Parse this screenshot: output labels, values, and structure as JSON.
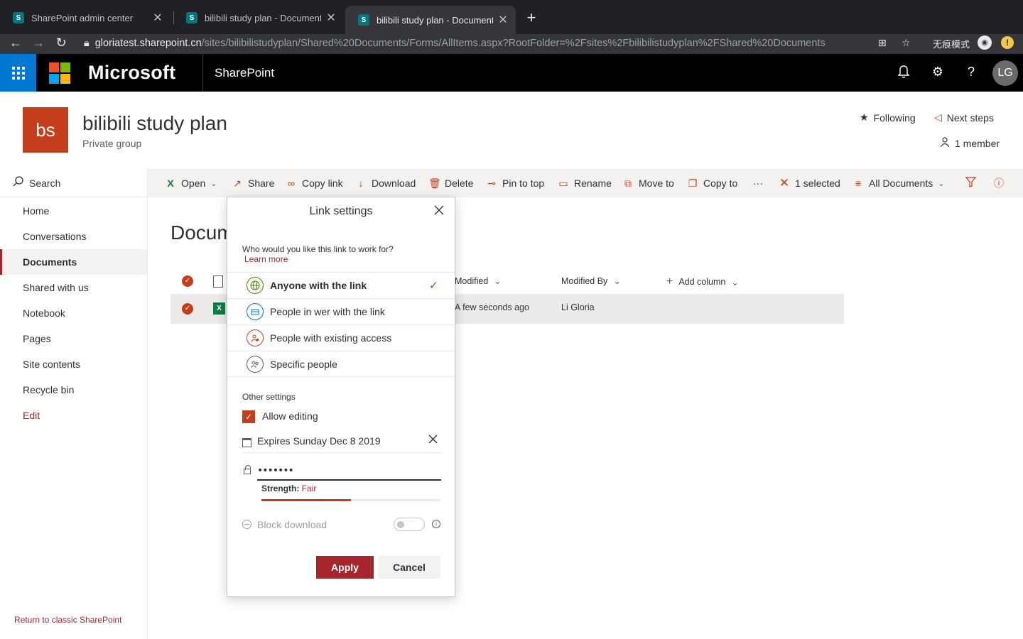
{
  "browser": {
    "tabs": [
      {
        "title": "SharePoint admin center",
        "favicon": "S"
      },
      {
        "title": "bilibili study plan - Documents",
        "favicon": "S"
      },
      {
        "title": "bilibili study plan - Documents",
        "favicon": "S"
      }
    ],
    "url_host": "gloriatest.sharepoint.cn",
    "url_path": "/sites/bilibilistudyplan/Shared%20Documents/Forms/AllItems.aspx?RootFolder=%2Fsites%2Fbilibilistudyplan%2FShared%20Documents",
    "incognito_label": "无痕模式"
  },
  "suitebar": {
    "brand": "Microsoft",
    "app": "SharePoint",
    "avatar_initials": "LG"
  },
  "site": {
    "logo_initials": "bs",
    "title": "bilibili study plan",
    "subtitle": "Private group",
    "following": "Following",
    "next_steps": "Next steps",
    "members": "1 member"
  },
  "leftnav": {
    "search": "Search",
    "items": [
      "Home",
      "Conversations",
      "Documents",
      "Shared with us",
      "Notebook",
      "Pages",
      "Site contents",
      "Recycle bin",
      "Edit"
    ],
    "classic": "Return to classic SharePoint"
  },
  "commands": {
    "open": "Open",
    "share": "Share",
    "copy_link": "Copy link",
    "download": "Download",
    "delete": "Delete",
    "pin": "Pin to top",
    "rename": "Rename",
    "move": "Move to",
    "copy_to": "Copy to",
    "more": "···",
    "selected": "1 selected",
    "view": "All Documents"
  },
  "list": {
    "heading": "Docum",
    "columns": {
      "modified": "Modified",
      "modified_by": "Modified By",
      "add_column": "Add column"
    },
    "rows": [
      {
        "modified": "A few seconds ago",
        "modified_by": "Li Gloria"
      }
    ]
  },
  "panel": {
    "title": "Link settings",
    "question": "Who would you like this link to work for?",
    "learn_more": "Learn more",
    "options": [
      {
        "label": "Anyone with the link",
        "icon": "globe-icon",
        "selected": true
      },
      {
        "label": "People in wer with the link",
        "icon": "building-icon",
        "selected": false
      },
      {
        "label": "People with existing access",
        "icon": "people-lock-icon",
        "selected": false
      },
      {
        "label": "Specific people",
        "icon": "people-icon",
        "selected": false
      }
    ],
    "other_settings": "Other settings",
    "allow_editing": "Allow editing",
    "allow_editing_checked": true,
    "expires": "Expires Sunday Dec 8 2019",
    "password_value": "•••••••",
    "strength_label": "Strength:",
    "strength_value": "Fair",
    "strength_fraction": 0.5,
    "block_download": "Block download",
    "block_download_on": false,
    "apply": "Apply",
    "cancel": "Cancel"
  },
  "colors": {
    "accent": "#c43e1c",
    "accent_dark": "#a4262c",
    "suite_bg": "#000000",
    "waffle_bg": "#0078d4"
  }
}
